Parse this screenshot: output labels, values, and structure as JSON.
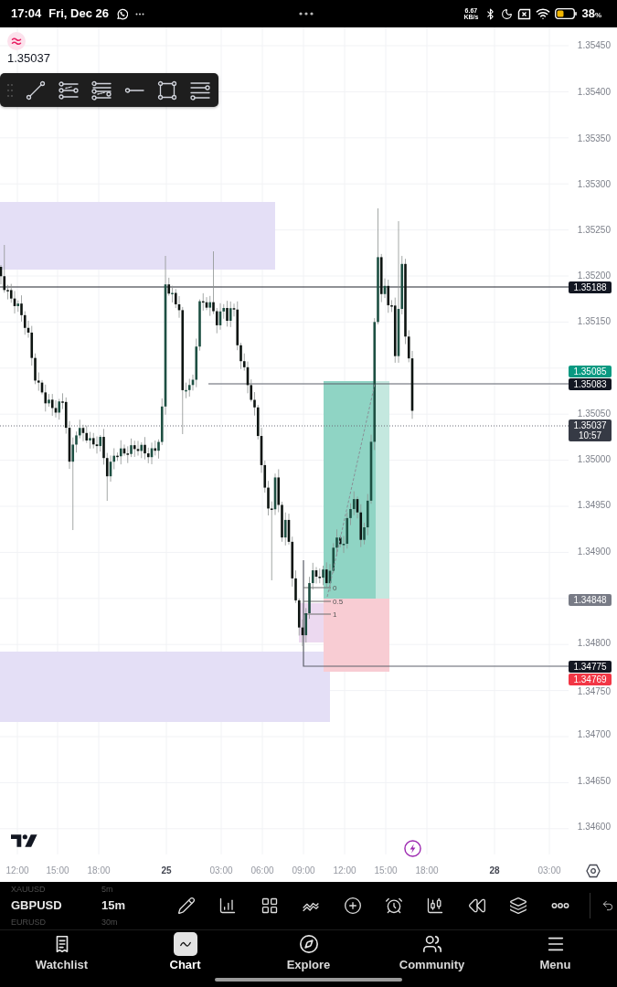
{
  "status_bar": {
    "time": "17:04",
    "date": "Fri, Dec 26",
    "network_speed": "6.67",
    "network_speed_unit": "KB/s",
    "battery": "38",
    "battery_unit": "%"
  },
  "symbol_header": {
    "price": "1.35037"
  },
  "chart": {
    "price_axis": [
      "1.35450",
      "1.35400",
      "1.35350",
      "1.35300",
      "1.35250",
      "1.35200",
      "1.35150",
      "1.35050",
      "1.35000",
      "1.34950",
      "1.34900",
      "1.34800",
      "1.34750",
      "1.34700",
      "1.34650",
      "1.34600"
    ],
    "time_axis": [
      {
        "text": "12:00",
        "kind": "time"
      },
      {
        "text": "15:00",
        "kind": "time"
      },
      {
        "text": "18:00",
        "kind": "time"
      },
      {
        "text": "25",
        "kind": "day"
      },
      {
        "text": "03:00",
        "kind": "time"
      },
      {
        "text": "06:00",
        "kind": "time"
      },
      {
        "text": "09:00",
        "kind": "time"
      },
      {
        "text": "12:00",
        "kind": "time"
      },
      {
        "text": "15:00",
        "kind": "time"
      },
      {
        "text": "18:00",
        "kind": "time"
      },
      {
        "text": "28",
        "kind": "day"
      },
      {
        "text": "03:00",
        "kind": "time"
      }
    ],
    "price_tags": [
      {
        "text": "1.35188",
        "color": "#131722"
      },
      {
        "text": "1.35085",
        "color": "#089981"
      },
      {
        "text": "1.35083",
        "color": "#131722"
      },
      {
        "text": "1.35037",
        "countdown": "10:57",
        "color": "#363a45"
      },
      {
        "text": "1.34848",
        "color": "#787b86"
      },
      {
        "text": "1.34775",
        "color": "#131722"
      },
      {
        "text": "1.34769",
        "color": "#f23645"
      }
    ],
    "fib_levels": [
      "0",
      "0.5",
      "1"
    ]
  },
  "symbol_picker": [
    {
      "symbol": "XAUUSD",
      "interval": "5m",
      "selected": false
    },
    {
      "symbol": "GBPUSD",
      "interval": "15m",
      "selected": true
    },
    {
      "symbol": "EURUSD",
      "interval": "30m",
      "selected": false
    }
  ],
  "nav": [
    {
      "label": "Watchlist",
      "selected": false
    },
    {
      "label": "Chart",
      "selected": true
    },
    {
      "label": "Explore",
      "selected": false
    },
    {
      "label": "Community",
      "selected": false
    },
    {
      "label": "Menu",
      "selected": false
    }
  ]
}
